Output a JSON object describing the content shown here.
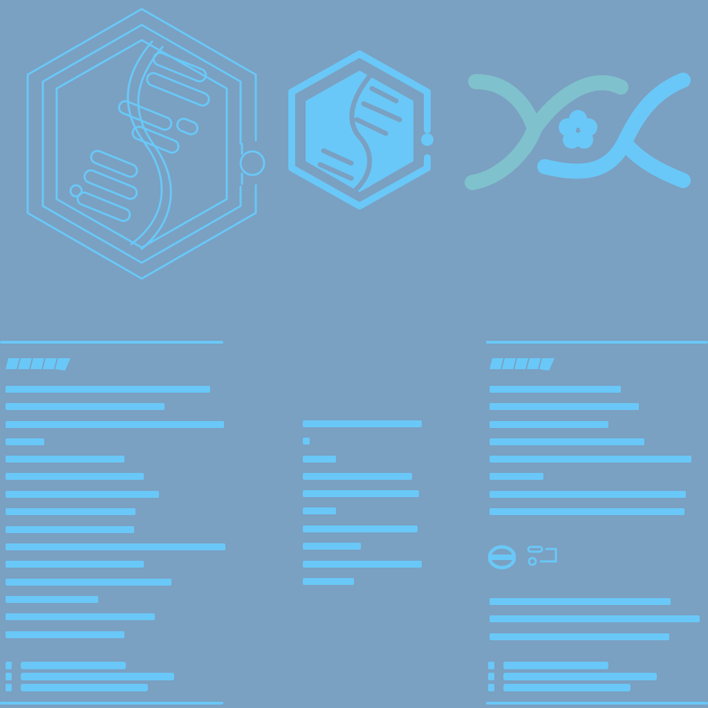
{
  "palette": {
    "background": "#7aa0c2",
    "accent": "#69c8f7",
    "accent_teal": "#7fc1cc"
  },
  "icons": {
    "large": "dna-hexagon-outline-icon",
    "medium": "dna-hexagon-filled-icon",
    "small": "dna-strand-flower-icon"
  }
}
